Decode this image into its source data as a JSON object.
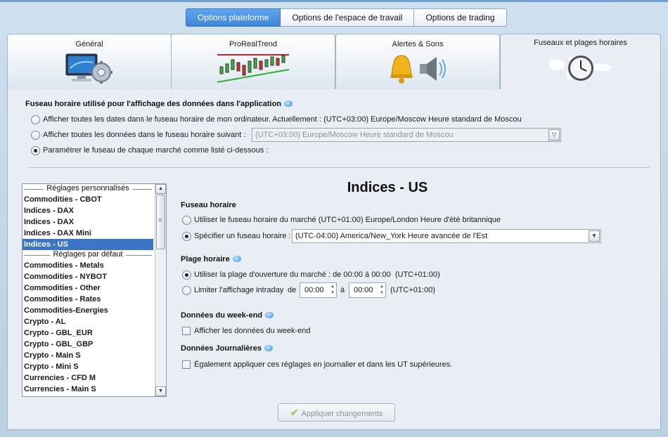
{
  "top_tabs": [
    "Options plateforme",
    "Options de l'espace de travail",
    "Options de trading"
  ],
  "category_tabs": [
    "Général",
    "ProRealTrend",
    "Alertes & Sons",
    "Fuseaux et plages horaires"
  ],
  "timezone_section": {
    "title": "Fuseau horaire utilisé pour l'affichage des données dans l'application",
    "option1": "Afficher toutes les dates dans le fuseau horaire de mon ordinateur. Actuellement : (UTC+03:00) Europe/Moscow Heure standard de Moscou",
    "option2": "Afficher toutes les données dans le fuseau horaire suivant :",
    "option2_value": "(UTC+03:00) Europe/Moscow Heure standard de Moscou",
    "option3": "Paramétrer le fuseau de chaque marché comme listé ci-dessous :"
  },
  "market_list": {
    "group_custom": "Réglages personnalisés",
    "custom_items": [
      "Commodities - CBOT",
      "Indices - DAX",
      "Indices - DAX",
      "Indices - DAX Mini",
      "Indices - US"
    ],
    "group_default": "Réglages par défaut",
    "default_items": [
      "Commodities - Metals",
      "Commodities - NYBOT",
      "Commodities - Other",
      "Commodities - Rates",
      "Commodities-Energies",
      "Crypto - AL",
      "Crypto - GBL_EUR",
      "Crypto - GBL_GBP",
      "Crypto - Main S",
      "Crypto - Mini S",
      "Currencies - CFD M",
      "Currencies - Main S"
    ]
  },
  "detail": {
    "heading": "Indices - US",
    "tz_title": "Fuseau horaire",
    "tz_opt1": "Utiliser le fuseau horaire du marché (UTC+01:00) Europe/London Heure d'été britannique",
    "tz_opt2": "Spécifier un fuseau horaire :",
    "tz_opt2_value": "(UTC-04:00) America/New_York Heure avancée de l'Est",
    "hours_title": "Plage horaire",
    "hours_opt1": "Utiliser la plage d'ouverture du marché : de 00:00 à 00:00",
    "hours_opt1_tz": "(UTC+01:00)",
    "hours_opt2": "Limiter l'affichage intraday",
    "hours_de": "de",
    "hours_a": "à",
    "hours_from": "00:00",
    "hours_to": "00:00",
    "hours_opt2_tz": "(UTC+01:00)",
    "weekend_title": "Données du week-end",
    "weekend_opt": "Afficher les données du week-end",
    "daily_title": "Données Journalières",
    "daily_opt": "Également appliquer ces réglages en journalier et dans les UT supérieures."
  },
  "apply_button": "Appliquer changements",
  "colors": {
    "accent": "#3f86d8",
    "selection": "#3c74c6",
    "panel": "#e8eef4"
  }
}
